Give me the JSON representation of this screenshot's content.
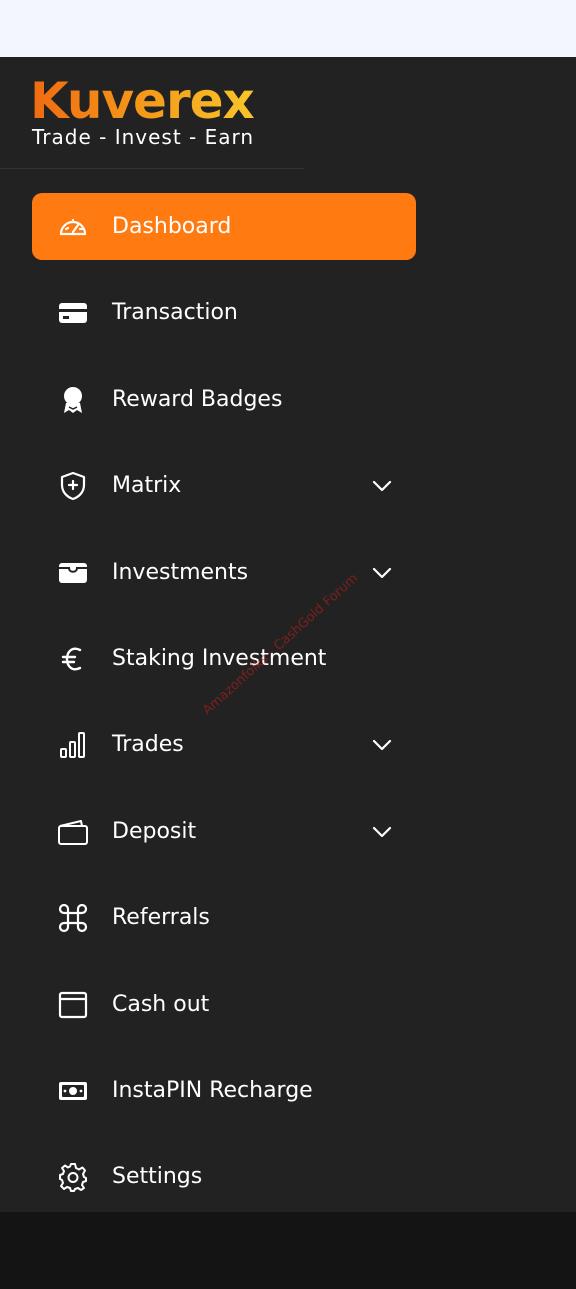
{
  "brand": {
    "name": "Kuverex",
    "tagline": "Trade - Invest - Earn"
  },
  "colors": {
    "accent": "#ff7a11",
    "sidebar_bg": "#222222",
    "text": "#ffffff"
  },
  "nav": {
    "items": [
      {
        "label": "Dashboard",
        "icon": "speedometer-icon",
        "active": true,
        "expandable": false
      },
      {
        "label": "Transaction",
        "icon": "credit-card-icon",
        "active": false,
        "expandable": false
      },
      {
        "label": "Reward Badges",
        "icon": "award-icon",
        "active": false,
        "expandable": false
      },
      {
        "label": "Matrix",
        "icon": "shield-plus-icon",
        "active": false,
        "expandable": true
      },
      {
        "label": "Investments",
        "icon": "wallet-icon",
        "active": false,
        "expandable": true
      },
      {
        "label": "Staking Investment",
        "icon": "euro-icon",
        "active": false,
        "expandable": false
      },
      {
        "label": "Trades",
        "icon": "bar-chart-icon",
        "active": false,
        "expandable": true
      },
      {
        "label": "Deposit",
        "icon": "wallet-outline-icon",
        "active": false,
        "expandable": true
      },
      {
        "label": "Referrals",
        "icon": "command-icon",
        "active": false,
        "expandable": false
      },
      {
        "label": "Cash out",
        "icon": "window-icon",
        "active": false,
        "expandable": false
      },
      {
        "label": "InstaPIN Recharge",
        "icon": "cash-icon",
        "active": false,
        "expandable": false
      },
      {
        "label": "Settings",
        "icon": "gear-icon",
        "active": false,
        "expandable": false
      }
    ]
  },
  "watermark": "Amazonfolks - CashGold Forum"
}
